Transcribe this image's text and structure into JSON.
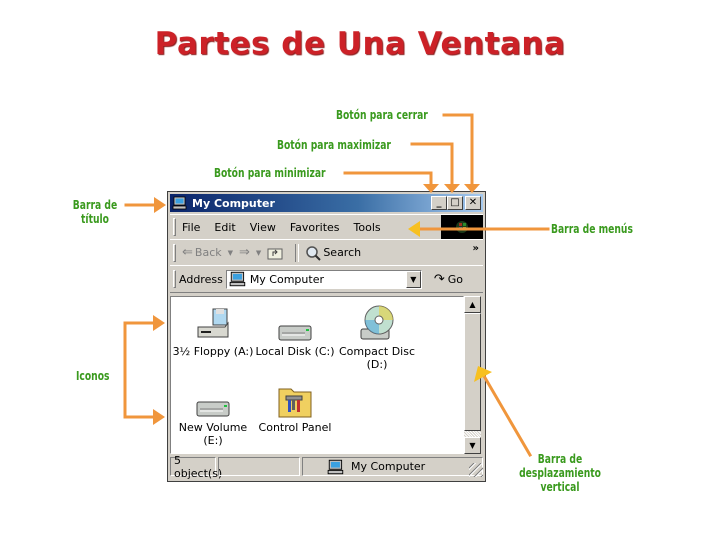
{
  "page_title": "Partes de Una Ventana",
  "callouts": {
    "close": "Botón para cerrar",
    "maximize": "Botón para maximizar",
    "minimize": "Botón para minimizar",
    "titlebar": [
      "Barra de",
      "título"
    ],
    "menubar": "Barra de menús",
    "icons": "Iconos",
    "scrollbar": [
      "Barra de",
      "desplazamiento",
      "vertical"
    ]
  },
  "colors": {
    "title": "#cc2127",
    "callout_text": "#3a9a1e",
    "arrow": "#f0963c",
    "titlebar_start": "#0a246a",
    "titlebar_end": "#a6caf0"
  },
  "window": {
    "title": "My Computer",
    "title_icon": "computer-icon",
    "buttons": {
      "minimize": "_",
      "maximize": "□",
      "close": "✕"
    },
    "menu": [
      "File",
      "Edit",
      "View",
      "Favorites",
      "Tools"
    ],
    "toolbar": {
      "back": "Back",
      "search": "Search",
      "more": "»"
    },
    "address": {
      "label": "Address",
      "value": "My Computer",
      "go": "Go"
    },
    "items": [
      {
        "label": "3½ Floppy (A:)",
        "icon": "floppy-drive-icon"
      },
      {
        "label": "Local Disk (C:)",
        "icon": "hard-disk-icon"
      },
      {
        "label": "Compact Disc (D:)",
        "icon": "cd-drive-icon"
      },
      {
        "label": "New Volume (E:)",
        "icon": "hard-disk-icon"
      },
      {
        "label": "Control Panel",
        "icon": "control-panel-icon"
      }
    ],
    "status": {
      "count": "5 object(s)",
      "zone": "My Computer"
    }
  }
}
